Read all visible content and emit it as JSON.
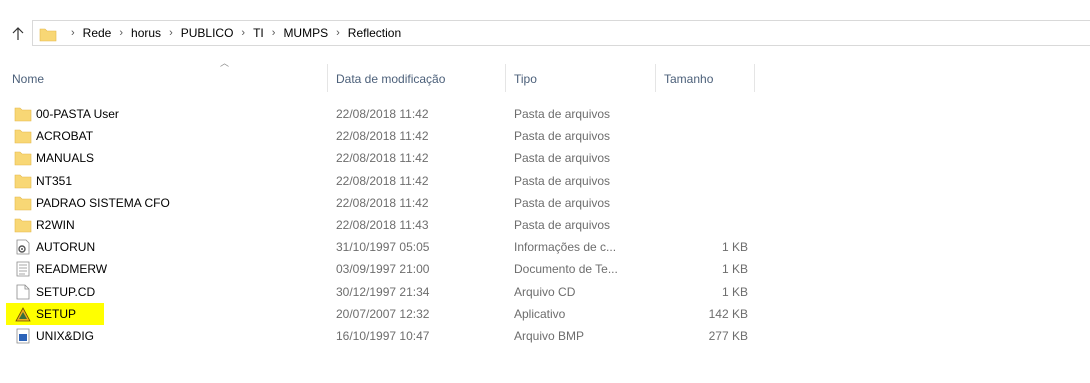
{
  "breadcrumb": {
    "items": [
      "Rede",
      "horus",
      "PUBLICO",
      "TI",
      "MUMPS",
      "Reflection"
    ]
  },
  "columns": {
    "name": "Nome",
    "date": "Data de modificação",
    "type": "Tipo",
    "size": "Tamanho"
  },
  "files": [
    {
      "name": "00-PASTA User",
      "date": "22/08/2018 11:42",
      "type": "Pasta de arquivos",
      "size": "",
      "icon": "folder-icon"
    },
    {
      "name": "ACROBAT",
      "date": "22/08/2018 11:42",
      "type": "Pasta de arquivos",
      "size": "",
      "icon": "folder-icon"
    },
    {
      "name": "MANUALS",
      "date": "22/08/2018 11:42",
      "type": "Pasta de arquivos",
      "size": "",
      "icon": "folder-icon"
    },
    {
      "name": "NT351",
      "date": "22/08/2018 11:42",
      "type": "Pasta de arquivos",
      "size": "",
      "icon": "folder-icon"
    },
    {
      "name": "PADRAO SISTEMA CFO",
      "date": "22/08/2018 11:42",
      "type": "Pasta de arquivos",
      "size": "",
      "icon": "folder-icon"
    },
    {
      "name": "R2WIN",
      "date": "22/08/2018 11:43",
      "type": "Pasta de arquivos",
      "size": "",
      "icon": "folder-icon"
    },
    {
      "name": "AUTORUN",
      "date": "31/10/1997 05:05",
      "type": "Informações de c...",
      "size": "1 KB",
      "icon": "settings-file-icon"
    },
    {
      "name": "READMERW",
      "date": "03/09/1997 21:00",
      "type": "Documento de Te...",
      "size": "1 KB",
      "icon": "text-document-icon"
    },
    {
      "name": "SETUP.CD",
      "date": "30/12/1997 21:34",
      "type": "Arquivo CD",
      "size": "1 KB",
      "icon": "blank-file-icon"
    },
    {
      "name": "SETUP",
      "date": "20/07/2007 12:32",
      "type": "Aplicativo",
      "size": "142 KB",
      "icon": "application-icon"
    },
    {
      "name": "UNIX&DIG",
      "date": "16/10/1997 10:47",
      "type": "Arquivo BMP",
      "size": "277 KB",
      "icon": "bitmap-image-icon"
    }
  ],
  "colors": {
    "folder": "#f8d775",
    "highlight": "#ffff00",
    "header_text": "#4c607a",
    "secondary_text": "#6d6d6d"
  }
}
